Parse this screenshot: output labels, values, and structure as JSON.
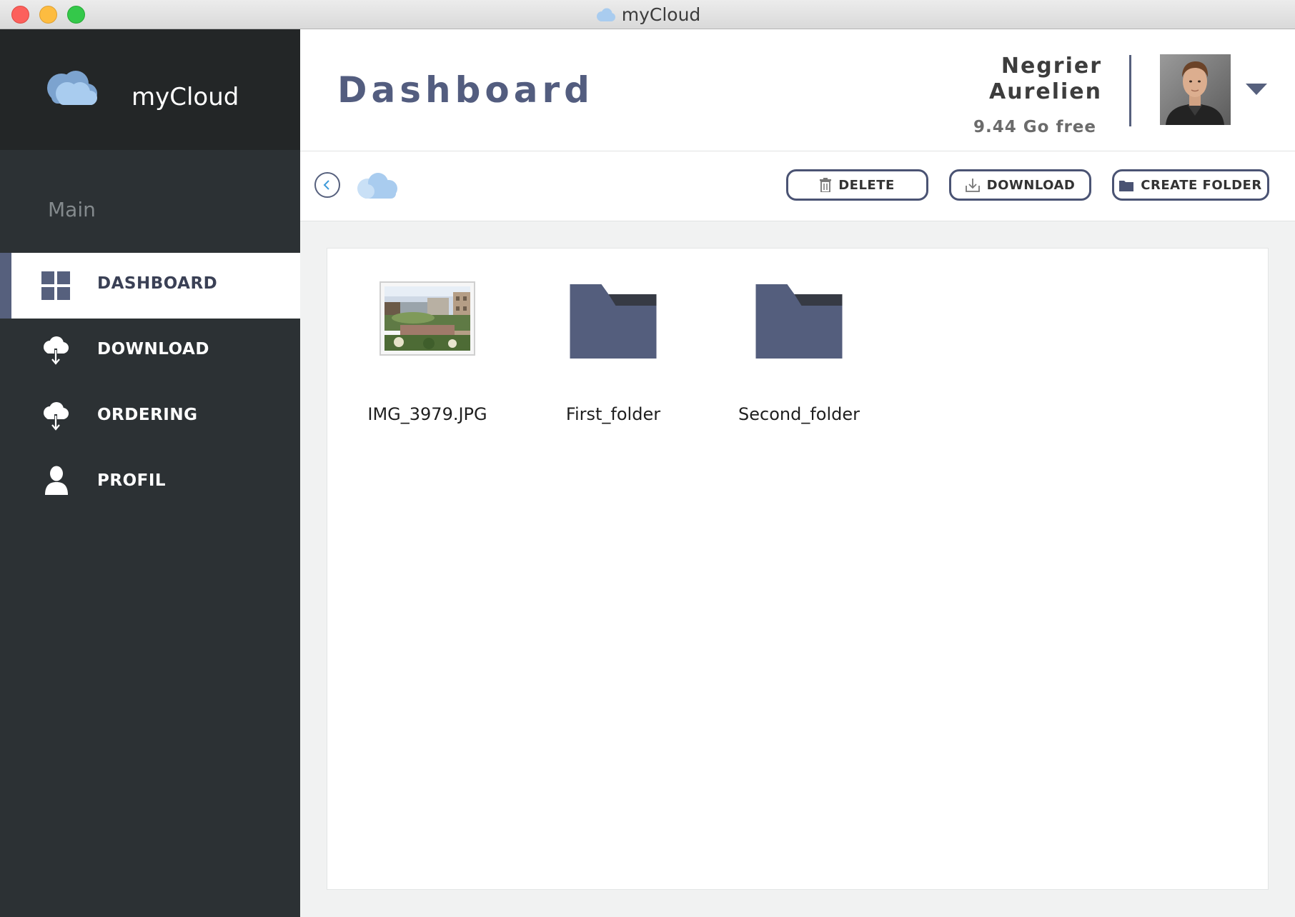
{
  "window": {
    "title": "myCloud"
  },
  "brand": {
    "name": "myCloud"
  },
  "sidebar": {
    "section": "Main",
    "items": [
      {
        "label": "DASHBOARD",
        "icon": "grid-icon",
        "active": true
      },
      {
        "label": "DOWNLOAD",
        "icon": "cloud-download-icon",
        "active": false
      },
      {
        "label": "ORDERING",
        "icon": "cloud-download-icon",
        "active": false
      },
      {
        "label": "PROFIL",
        "icon": "user-icon",
        "active": false
      }
    ]
  },
  "header": {
    "title": "Dashboard",
    "user": {
      "first_line": "Negrier",
      "second_line": "Aurelien",
      "storage": "9.44 Go free"
    }
  },
  "toolbar": {
    "delete_label": "DELETE",
    "download_label": "DOWNLOAD",
    "create_folder_label": "CREATE FOLDER"
  },
  "files": [
    {
      "name": "IMG_3979.JPG",
      "type": "image"
    },
    {
      "name": "First_folder",
      "type": "folder"
    },
    {
      "name": "Second_folder",
      "type": "folder"
    }
  ],
  "colors": {
    "accent": "#56607d",
    "sidebar": "#2c3134",
    "sidebar_brand": "#232627",
    "content_bg": "#f1f2f2",
    "cloud": "#a9ccef"
  }
}
